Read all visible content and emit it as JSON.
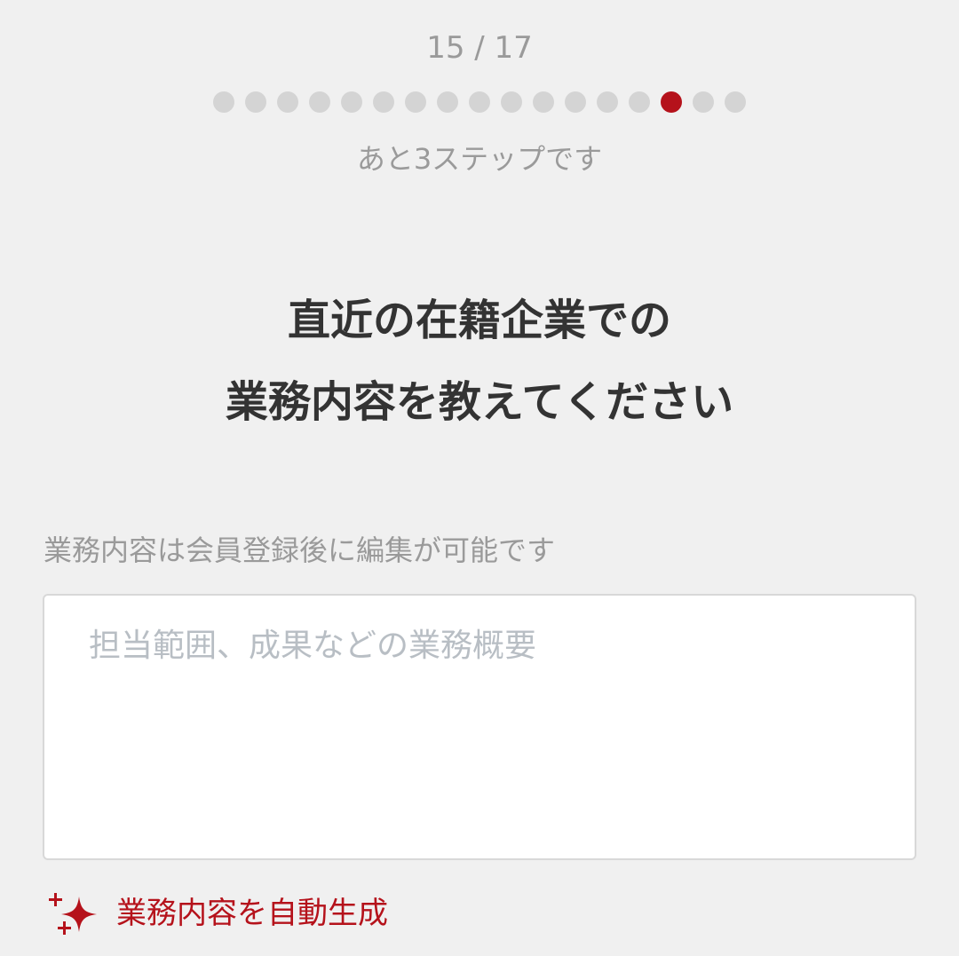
{
  "progress": {
    "counter_text": "15 / 17",
    "current_step": 15,
    "total_steps": 17,
    "remaining_text": "あと3ステップです",
    "active_color": "#b5121b",
    "inactive_color": "#d4d4d4"
  },
  "title": {
    "line1": "直近の在籍企業での",
    "line2": "業務内容を教えてください"
  },
  "form": {
    "helper_text": "業務内容は会員登録後に編集が可能です",
    "description_value": "",
    "description_placeholder": "担当範囲、成果などの業務概要"
  },
  "auto_generate": {
    "icon": "sparkle-icon",
    "label": "業務内容を自動生成",
    "color": "#b5121b"
  }
}
